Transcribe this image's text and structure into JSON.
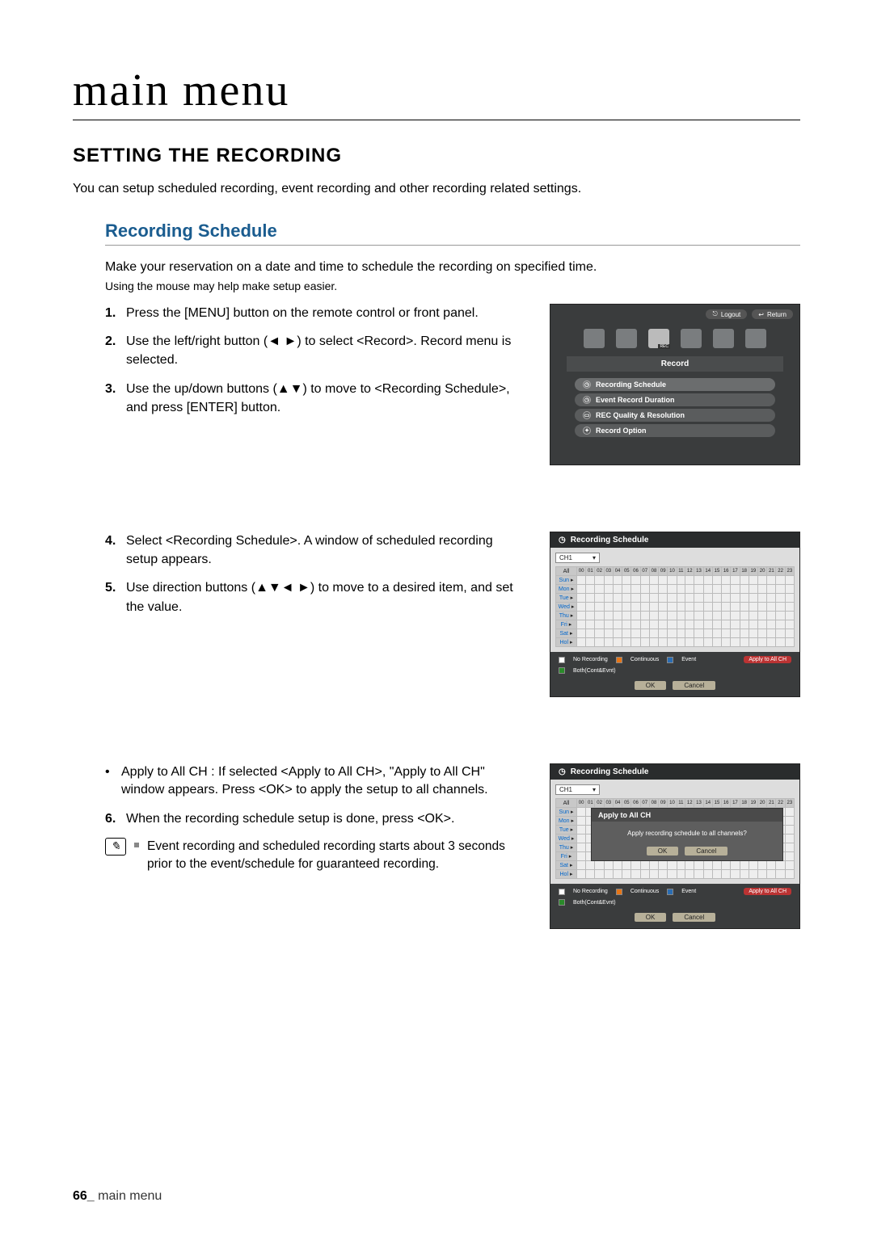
{
  "page": {
    "title": "main menu",
    "footer_page": "66_",
    "footer_text": "main menu"
  },
  "section": {
    "heading": "SETTING THE RECORDING",
    "intro": "You can setup scheduled recording, event recording and other recording related settings."
  },
  "sub": {
    "heading": "Recording Schedule",
    "desc": "Make your reservation on a date and time to schedule the recording on specified time.",
    "hint": "Using the mouse may help make setup easier."
  },
  "steps_a": [
    {
      "n": "1.",
      "t": "Press the [MENU] button on the remote control or front panel."
    },
    {
      "n": "2.",
      "t": "Use the left/right button (◄ ►) to select <Record>. Record menu is selected."
    },
    {
      "n": "3.",
      "t": "Use the up/down buttons (▲▼) to move to <Recording Schedule>, and press [ENTER] button."
    }
  ],
  "steps_b": [
    {
      "n": "4.",
      "t": "Select <Recording Schedule>. A window of scheduled recording setup appears."
    },
    {
      "n": "5.",
      "t": "Use direction buttons (▲▼◄ ►) to move to a desired item, and set the value."
    }
  ],
  "bullet_c": "Apply to All CH : If selected <Apply to All CH>, \"Apply to All CH\" window appears. Press <OK> to apply the setup to all channels.",
  "step_c6": {
    "n": "6.",
    "t": "When the recording schedule setup is done, press <OK>."
  },
  "note": "Event recording and scheduled recording starts about 3 seconds prior to the event/schedule for guaranteed recording.",
  "screenshot1": {
    "logout": "Logout",
    "return": "Return",
    "menu_title": "Record",
    "items": [
      "Recording Schedule",
      "Event Record Duration",
      "REC Quality & Resolution",
      "Record Option"
    ]
  },
  "schedule": {
    "title": "Recording Schedule",
    "channel": "CH1",
    "all": "All",
    "hours": [
      "00",
      "01",
      "02",
      "03",
      "04",
      "05",
      "06",
      "07",
      "08",
      "09",
      "10",
      "11",
      "12",
      "13",
      "14",
      "15",
      "16",
      "17",
      "18",
      "19",
      "20",
      "21",
      "22",
      "23"
    ],
    "days": [
      "Sun",
      "Mon",
      "Tue",
      "Wed",
      "Thu",
      "Fri",
      "Sat",
      "Hol"
    ],
    "legend": {
      "no": "No Recording",
      "cont": "Continuous",
      "event": "Event",
      "both": "Both(Cont&Evnt)"
    },
    "apply": "Apply to All CH",
    "ok": "OK",
    "cancel": "Cancel"
  },
  "modal": {
    "title": "Apply to All CH",
    "msg": "Apply recording schedule to all channels?",
    "ok": "OK",
    "cancel": "Cancel"
  }
}
